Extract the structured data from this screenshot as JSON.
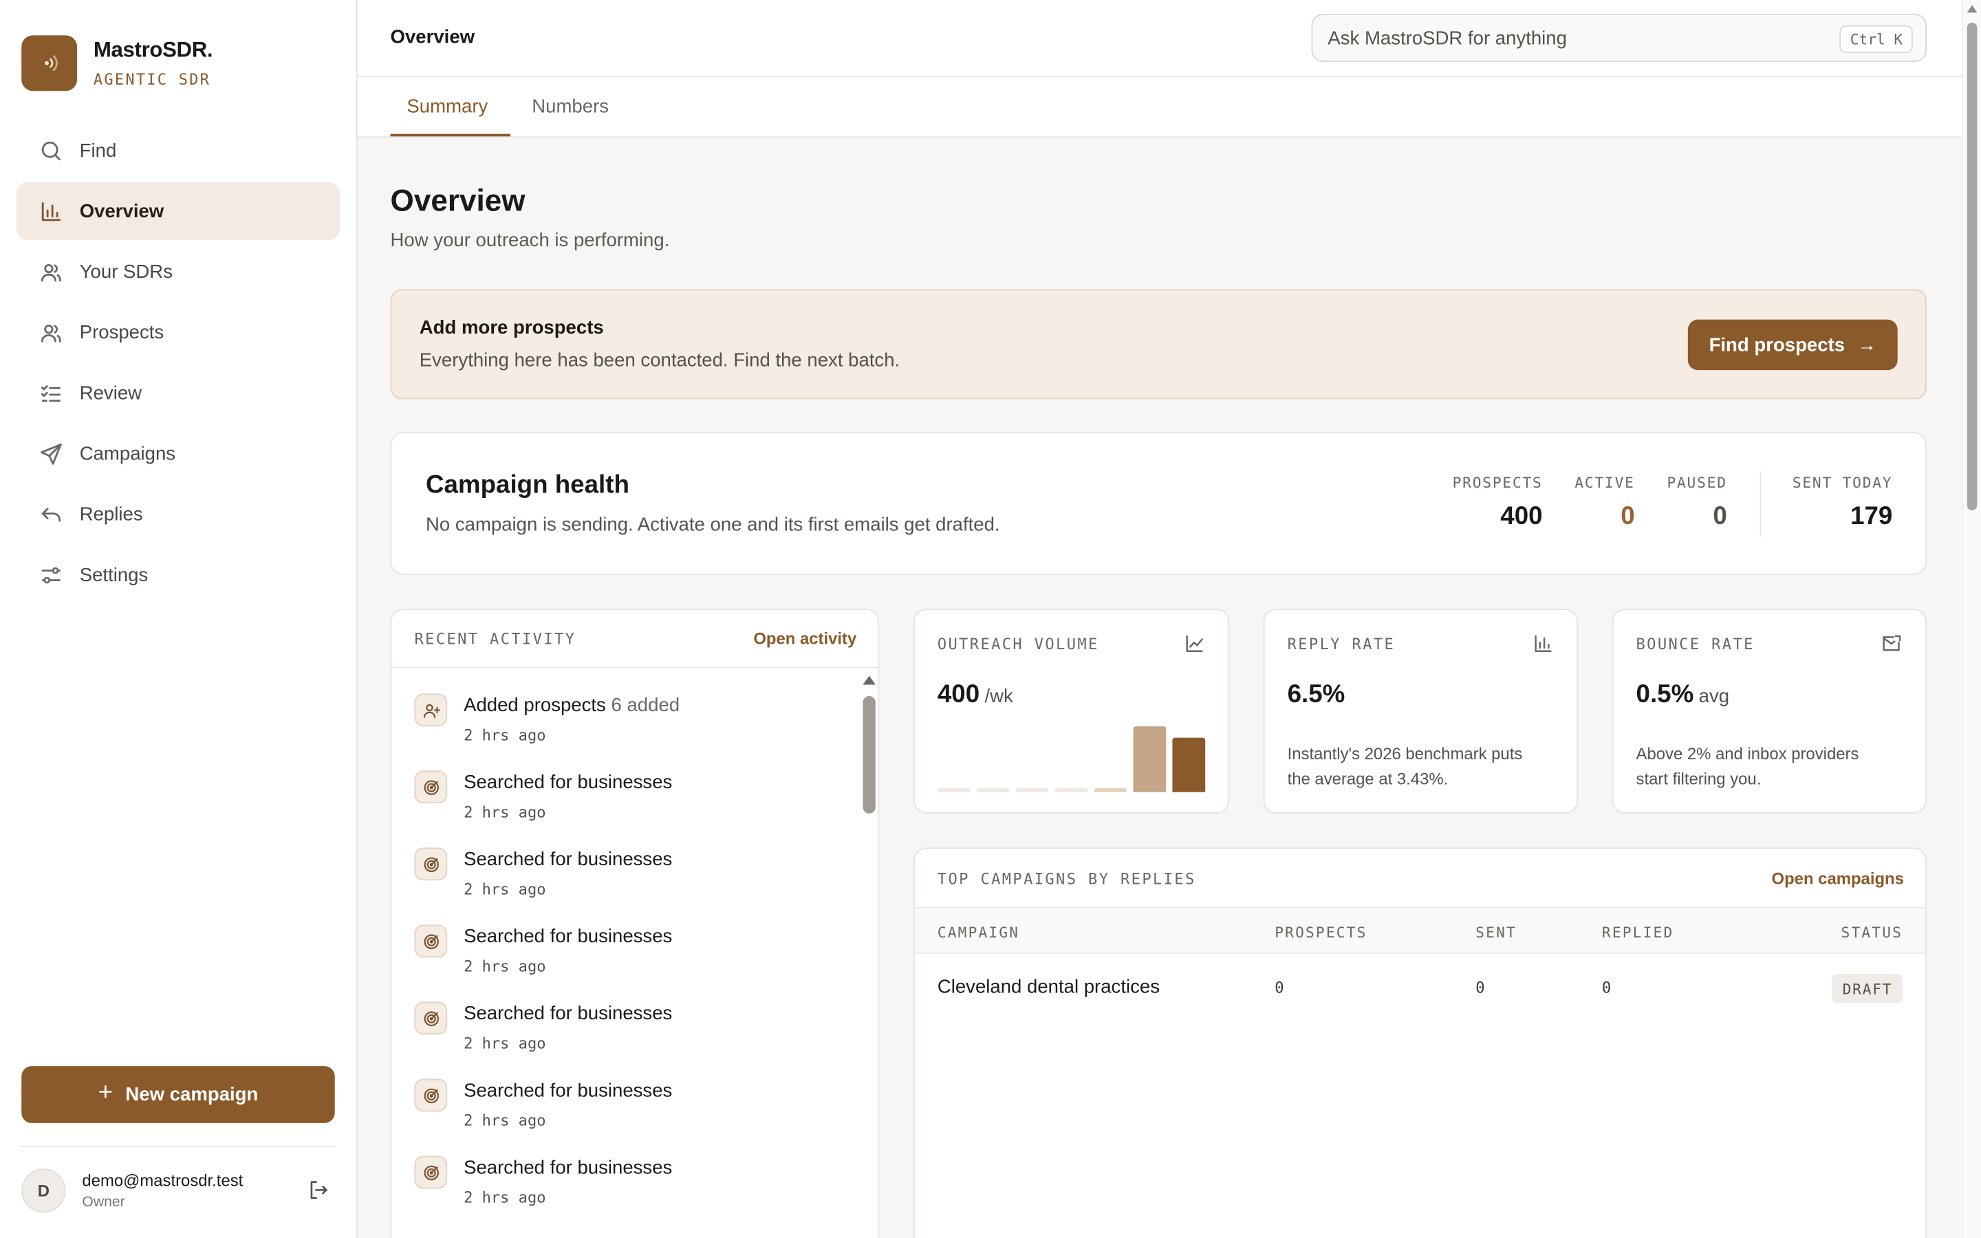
{
  "brand": {
    "name": "MastroSDR.",
    "tagline": "AGENTIC SDR"
  },
  "sidebar": {
    "items": [
      {
        "label": "Find",
        "icon": "search-icon"
      },
      {
        "label": "Overview",
        "icon": "bar-chart-icon",
        "active": true
      },
      {
        "label": "Your SDRs",
        "icon": "users-icon"
      },
      {
        "label": "Prospects",
        "icon": "users-icon"
      },
      {
        "label": "Review",
        "icon": "checklist-icon"
      },
      {
        "label": "Campaigns",
        "icon": "send-icon"
      },
      {
        "label": "Replies",
        "icon": "reply-icon"
      },
      {
        "label": "Settings",
        "icon": "sliders-icon"
      }
    ],
    "new_campaign_label": "New campaign",
    "user": {
      "initial": "D",
      "email": "demo@mastrosdr.test",
      "role": "Owner"
    }
  },
  "topbar": {
    "title": "Overview",
    "search_placeholder": "Ask MastroSDR for anything",
    "shortcut": "Ctrl K"
  },
  "tabs": [
    {
      "label": "Summary",
      "active": true
    },
    {
      "label": "Numbers"
    }
  ],
  "page": {
    "title": "Overview",
    "subtitle": "How your outreach is performing."
  },
  "banner": {
    "title": "Add more prospects",
    "text": "Everything here has been contacted. Find the next batch.",
    "button_label": "Find prospects"
  },
  "campaign_health": {
    "title": "Campaign health",
    "text": "No campaign is sending. Activate one and its first emails get drafted.",
    "stats": [
      {
        "label": "PROSPECTS",
        "value": "400"
      },
      {
        "label": "ACTIVE",
        "value": "0"
      },
      {
        "label": "PAUSED",
        "value": "0"
      },
      {
        "label": "SENT TODAY",
        "value": "179"
      }
    ]
  },
  "recent_activity": {
    "label": "RECENT ACTIVITY",
    "link": "Open activity",
    "items": [
      {
        "title": "Added prospects",
        "detail": "6 added",
        "time": "2 hrs ago",
        "icon": "user-plus-icon"
      },
      {
        "title": "Searched for businesses",
        "detail": "",
        "time": "2 hrs ago",
        "icon": "target-icon"
      },
      {
        "title": "Searched for businesses",
        "detail": "",
        "time": "2 hrs ago",
        "icon": "target-icon"
      },
      {
        "title": "Searched for businesses",
        "detail": "",
        "time": "2 hrs ago",
        "icon": "target-icon"
      },
      {
        "title": "Searched for businesses",
        "detail": "",
        "time": "2 hrs ago",
        "icon": "target-icon"
      },
      {
        "title": "Searched for businesses",
        "detail": "",
        "time": "2 hrs ago",
        "icon": "target-icon"
      },
      {
        "title": "Searched for businesses",
        "detail": "",
        "time": "2 hrs ago",
        "icon": "target-icon"
      }
    ]
  },
  "metrics": {
    "outreach": {
      "label": "OUTREACH VOLUME",
      "value": "400",
      "unit": "/wk",
      "icon": "line-chart-icon",
      "bars": [
        0.05,
        0.05,
        0.05,
        0.05,
        0.06,
        0.9,
        0.74
      ],
      "bar_colors": [
        "#efe8e1",
        "#efe8e1",
        "#efe8e1",
        "#efe8e1",
        "#e6cfb8",
        "#c4a587",
        "#8a5a2b"
      ]
    },
    "reply": {
      "label": "REPLY RATE",
      "value": "6.5%",
      "icon": "bar-chart-icon",
      "note": "Instantly's 2026 benchmark puts the average at 3.43%."
    },
    "bounce": {
      "label": "BOUNCE RATE",
      "value": "0.5%",
      "unit": "avg",
      "icon": "mail-icon",
      "note": "Above 2% and inbox providers start filtering you."
    }
  },
  "top_campaigns": {
    "label": "TOP CAMPAIGNS BY REPLIES",
    "link": "Open campaigns",
    "columns": [
      "CAMPAIGN",
      "PROSPECTS",
      "SENT",
      "REPLIED",
      "STATUS"
    ],
    "rows": [
      {
        "campaign": "Cleveland dental practices",
        "prospects": "0",
        "sent": "0",
        "replied": "0",
        "status": "DRAFT"
      }
    ]
  },
  "colors": {
    "accent": "#8a5a2b",
    "accent_soft": "#f5ece4",
    "active_stat": "#9a6230"
  }
}
